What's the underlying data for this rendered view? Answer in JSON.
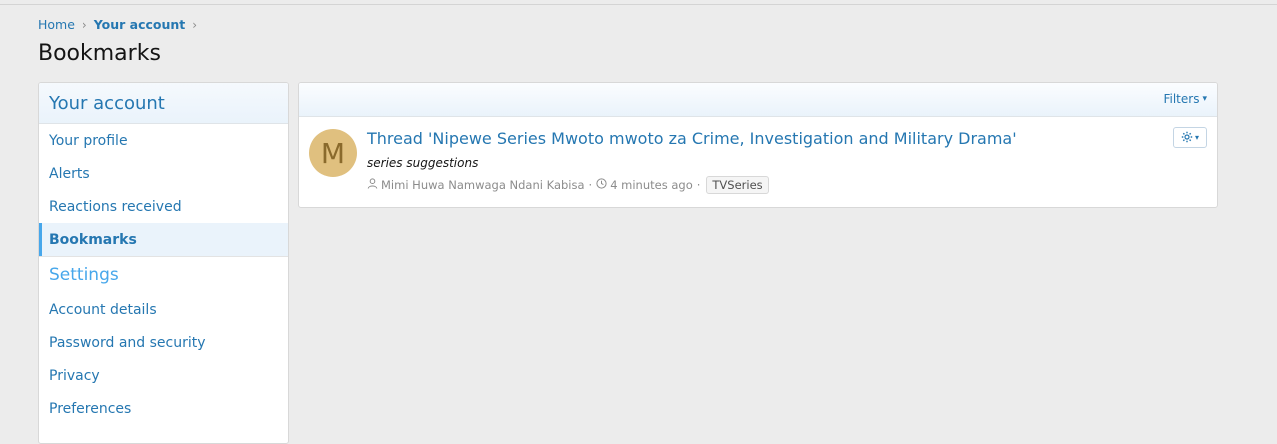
{
  "breadcrumb": {
    "home": "Home",
    "account": "Your account",
    "sep": "›"
  },
  "page": {
    "title": "Bookmarks"
  },
  "sidebar": {
    "header": "Your account",
    "items": [
      {
        "label": "Your profile"
      },
      {
        "label": "Alerts"
      },
      {
        "label": "Reactions received"
      },
      {
        "label": "Bookmarks",
        "active": true
      }
    ],
    "settings_header": "Settings",
    "settings_items": [
      {
        "label": "Account details"
      },
      {
        "label": "Password and security"
      },
      {
        "label": "Privacy"
      },
      {
        "label": "Preferences"
      }
    ]
  },
  "filters": {
    "label": "Filters",
    "caret": "▾"
  },
  "bookmark": {
    "avatar_letter": "M",
    "title": "Thread 'Nipewe Series Mwoto mwoto za Crime, Investigation and Military Drama'",
    "snippet": "series suggestions",
    "author": "Mimi Huwa Namwaga Ndani Kabisa",
    "time": "4 minutes ago",
    "tag": "TVSeries",
    "dot": "·",
    "user_icon": "user-icon",
    "clock_icon": "clock-icon"
  },
  "colors": {
    "link": "#2577b1",
    "accent": "#47a7eb",
    "avatar_bg": "#e0c07f"
  }
}
